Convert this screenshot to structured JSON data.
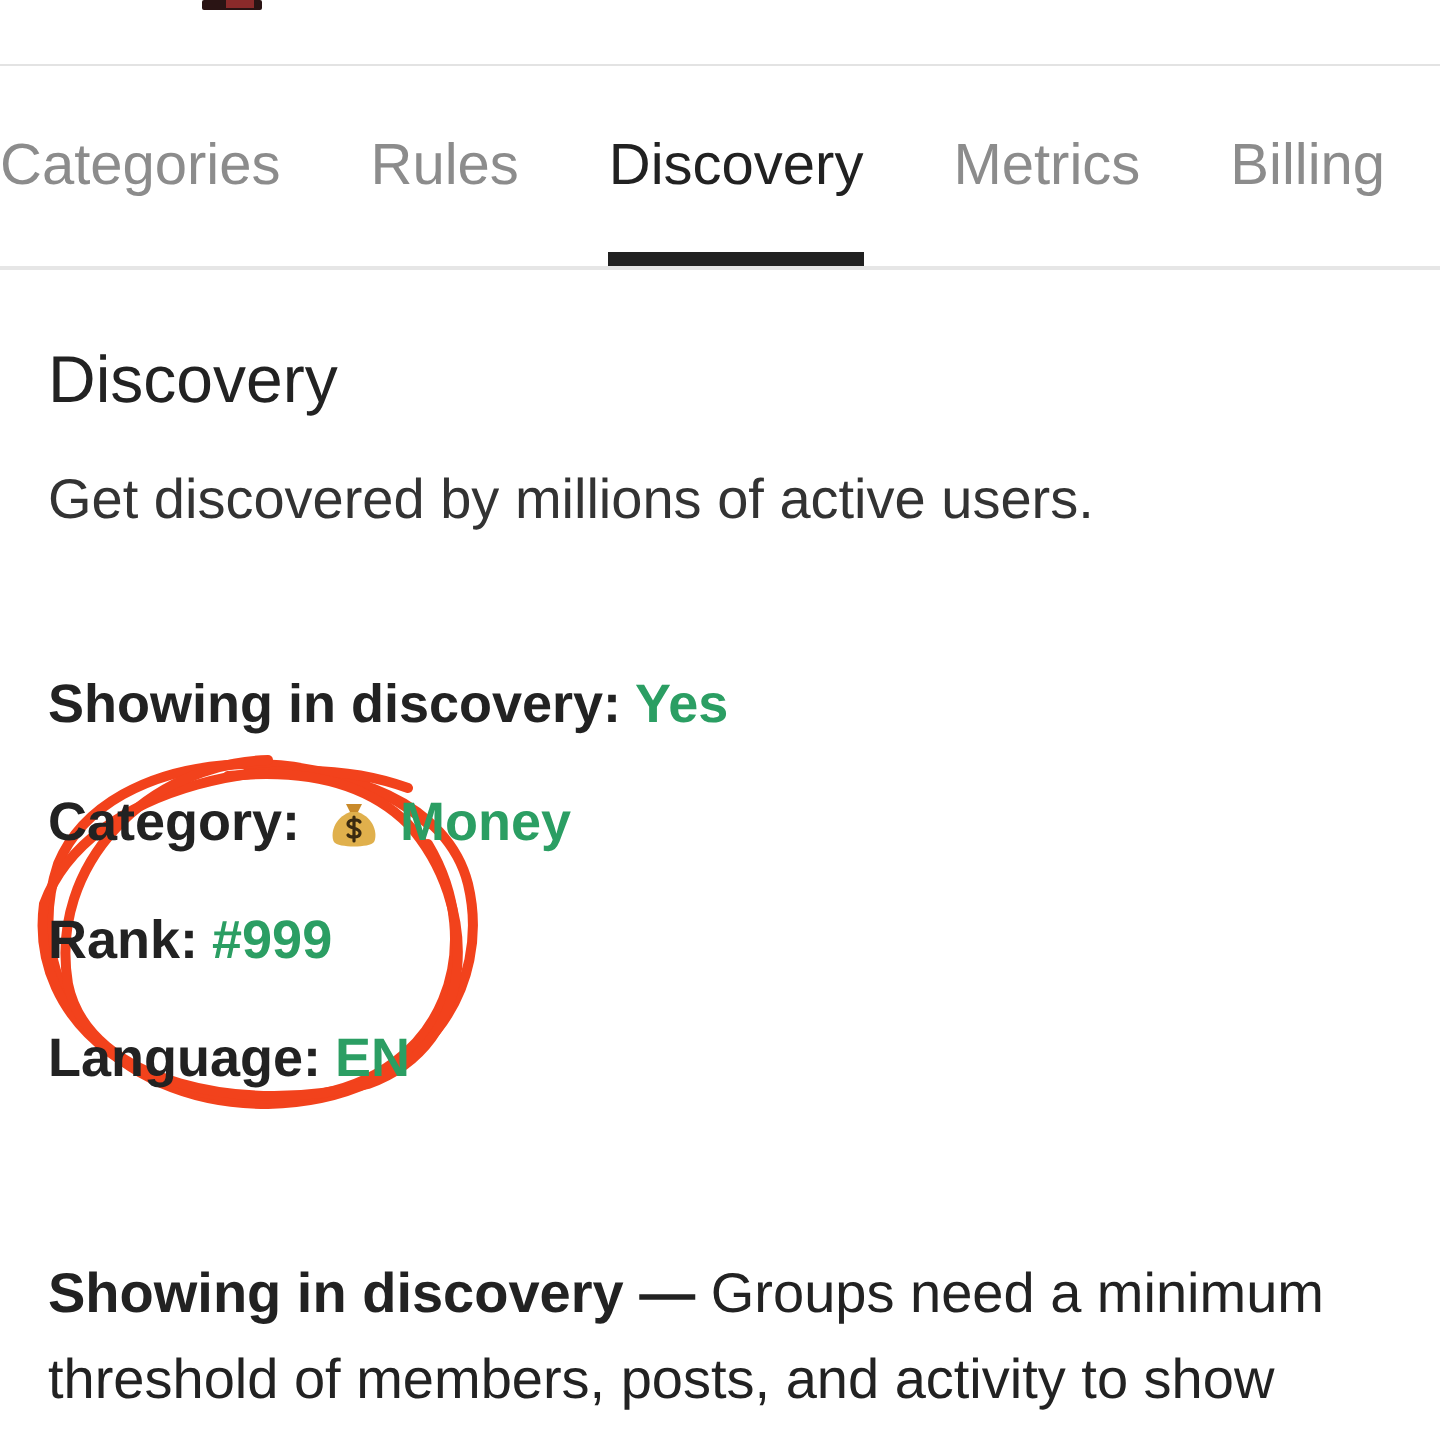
{
  "tabs": [
    {
      "label": "Categories",
      "selected": false
    },
    {
      "label": "Rules",
      "selected": false
    },
    {
      "label": "Discovery",
      "selected": true
    },
    {
      "label": "Metrics",
      "selected": false
    },
    {
      "label": "Billing",
      "selected": false
    }
  ],
  "section": {
    "title": "Discovery",
    "subtitle": "Get discovered by millions of active users."
  },
  "details": [
    {
      "kind": "plain",
      "label": "Showing in discovery:",
      "value": "Yes"
    },
    {
      "kind": "with_icon",
      "label": "Category:",
      "value": "Money"
    },
    {
      "kind": "plain",
      "label": "Rank:",
      "value": "#999"
    },
    {
      "kind": "plain",
      "label": "Language:",
      "value": "EN"
    }
  ],
  "note": "**Showing in discovery —** Groups need a minimum threshold of members, posts, and activity to show"
}
